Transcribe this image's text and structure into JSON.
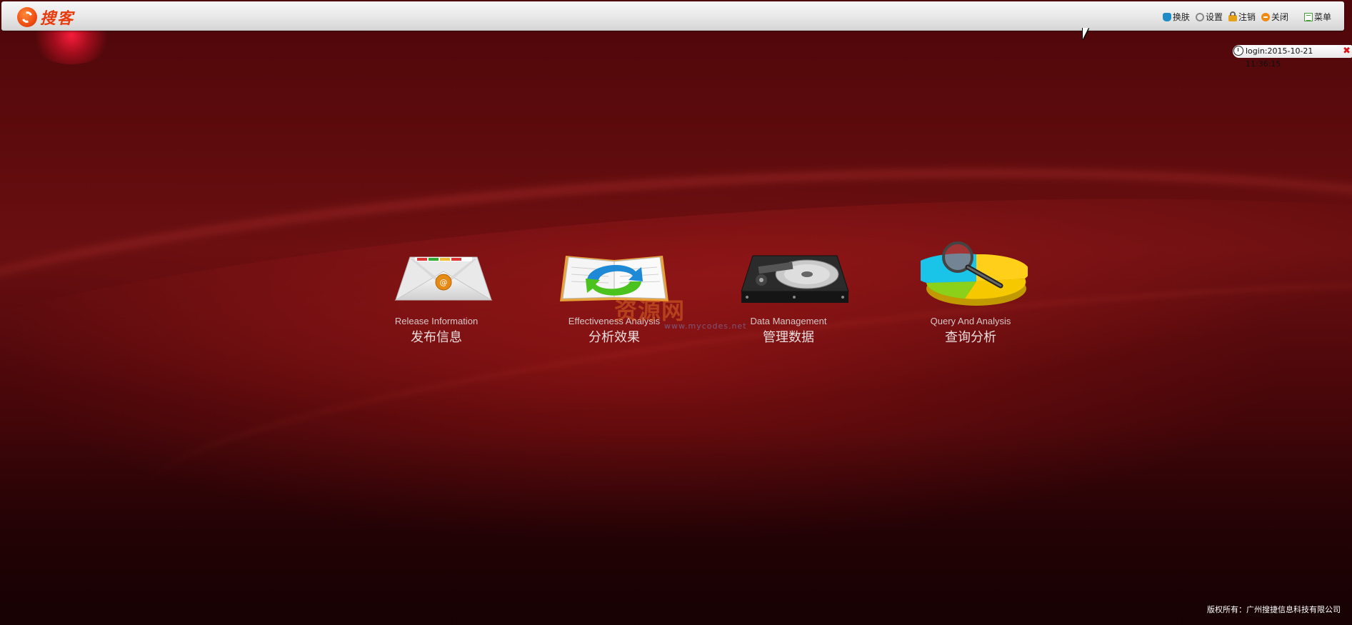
{
  "app": {
    "logo_text": "搜客"
  },
  "top_menu": {
    "skin": "换肤",
    "settings": "设置",
    "logout": "注销",
    "close": "关闭",
    "menu": "菜单"
  },
  "login_badge": {
    "text": "login:2015-10-21 11:36:15",
    "close_glyph": "✖"
  },
  "features": [
    {
      "en": "Release Information",
      "cn": "发布信息",
      "icon": "envelope-icon"
    },
    {
      "en": "Effectiveness Analysis",
      "cn": "分析效果",
      "icon": "analysis-book-icon"
    },
    {
      "en": "Data Management",
      "cn": "管理数据",
      "icon": "hard-disk-icon"
    },
    {
      "en": "Query And Analysis",
      "cn": "查询分析",
      "icon": "pie-chart-magnifier-icon"
    }
  ],
  "watermark": {
    "text": "资源网",
    "sub": "www.mycodes.net"
  },
  "footer": {
    "copyright": "版权所有：广州搜捷信息科技有限公司"
  },
  "colors": {
    "background": "#5a0a0c",
    "accent": "#e83b0d",
    "topbar": "#e8e8e8"
  }
}
